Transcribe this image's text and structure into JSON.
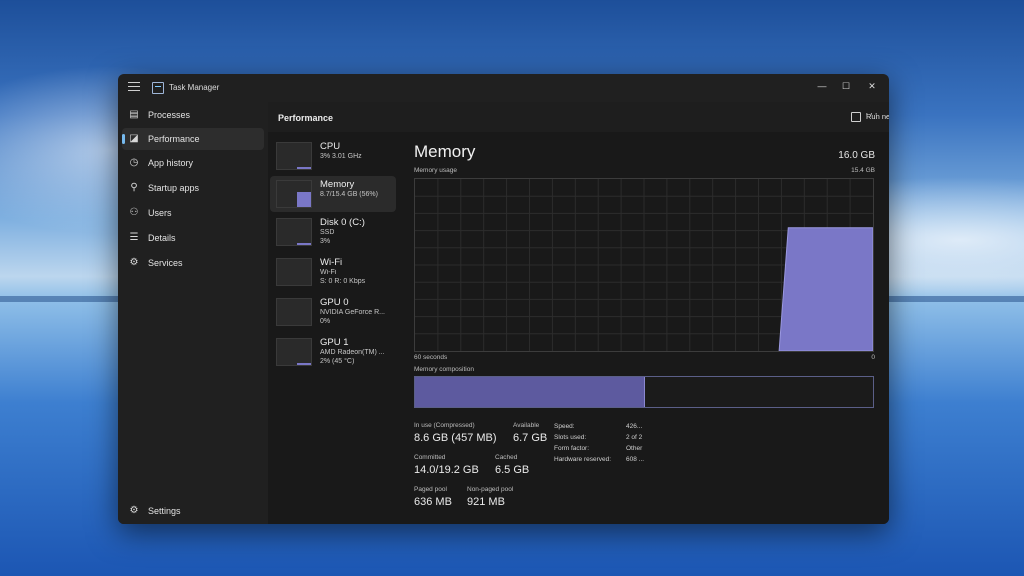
{
  "window": {
    "title": "Task Manager"
  },
  "sidebar": {
    "items": [
      {
        "label": "Processes",
        "icon": "processes-icon",
        "glyph": "▤"
      },
      {
        "label": "Performance",
        "icon": "performance-icon",
        "glyph": "◪"
      },
      {
        "label": "App history",
        "icon": "history-icon",
        "glyph": "◷"
      },
      {
        "label": "Startup apps",
        "icon": "startup-icon",
        "glyph": "⚲"
      },
      {
        "label": "Users",
        "icon": "users-icon",
        "glyph": "⚇"
      },
      {
        "label": "Details",
        "icon": "details-icon",
        "glyph": "☰"
      },
      {
        "label": "Services",
        "icon": "services-icon",
        "glyph": "⚙"
      }
    ],
    "settings": {
      "label": "Settings",
      "icon": "gear-icon",
      "glyph": "⚙"
    }
  },
  "header": {
    "title": "Performance",
    "run_new_task": "Run new task",
    "more": "···"
  },
  "devices": [
    {
      "name": "CPU",
      "sub1": "3% 3.01 GHz",
      "sub2": "",
      "level": 0.03
    },
    {
      "name": "Memory",
      "sub1": "8.7/15.4 GB (56%)",
      "sub2": "",
      "level": 0.56
    },
    {
      "name": "Disk 0 (C:)",
      "sub1": "SSD",
      "sub2": "3%",
      "level": 0.03
    },
    {
      "name": "Wi-Fi",
      "sub1": "Wi-Fi",
      "sub2": "S: 0 R: 0 Kbps",
      "level": 0.0
    },
    {
      "name": "GPU 0",
      "sub1": "NVIDIA GeForce R...",
      "sub2": "0%",
      "level": 0.0
    },
    {
      "name": "GPU 1",
      "sub1": "AMD Radeon(TM) ...",
      "sub2": "2% (45 °C)",
      "level": 0.02
    }
  ],
  "memory": {
    "title": "Memory",
    "total": "16.0 GB",
    "usage_label": "Memory usage",
    "usage_max": "15.4 GB",
    "x_left": "60 seconds",
    "x_right": "0",
    "composition_label": "Memory composition",
    "in_use_fraction": 0.5,
    "graph_level": 0.56,
    "stats": {
      "in_use_label": "In use (Compressed)",
      "in_use_value": "8.6 GB (457 MB)",
      "available_label": "Available",
      "available_value": "6.7 GB",
      "committed_label": "Committed",
      "committed_value": "14.0/19.2 GB",
      "cached_label": "Cached",
      "cached_value": "6.5 GB",
      "paged_label": "Paged pool",
      "paged_value": "636 MB",
      "nonpaged_label": "Non-paged pool",
      "nonpaged_value": "921 MB"
    },
    "info": [
      {
        "label": "Speed:",
        "value": "426..."
      },
      {
        "label": "Slots used:",
        "value": "2 of 2"
      },
      {
        "label": "Form factor:",
        "value": "Other"
      },
      {
        "label": "Hardware reserved:",
        "value": "608 ..."
      }
    ]
  },
  "colors": {
    "accent": "#76b9ed",
    "memory_fill": "#7a77c7",
    "composition_fill": "#5d5a9f"
  }
}
